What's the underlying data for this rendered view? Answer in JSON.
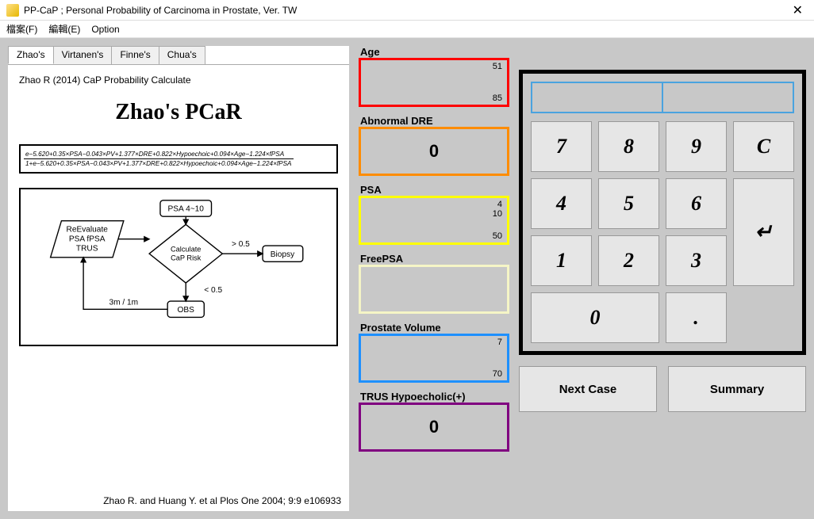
{
  "window": {
    "title": "PP-CaP ; Personal Probability of Carcinoma in Prostate, Ver. TW",
    "close": "✕"
  },
  "menubar": {
    "file": "檔案(F)",
    "edit": "編輯(E)",
    "option": "Option"
  },
  "tabs": {
    "zhao": "Zhao's",
    "virtanen": "Virtanen's",
    "finne": "Finne's",
    "chua": "Chua's"
  },
  "doc": {
    "subtitle": "Zhao R (2014) CaP Probability Calculate",
    "title": "Zhao's PCaR",
    "formula_num": "e−5.620+0.35×PSA−0.043×PV+1.377×DRE+0.822×Hypoechoic+0.094×Age−1.224×fPSA",
    "formula_den": "1+e−5.620+0.35×PSA−0.043×PV+1.377×DRE+0.822×Hypoechoic+0.094×Age−1.224×fPSA",
    "citation": "Zhao R.  and Huang Y. et al   Plos One 2004; 9:9 e106933",
    "flow": {
      "psa_range": "PSA 4~10",
      "reeval_l1": "ReEvaluate",
      "reeval_l2": "PSA  fPSA",
      "reeval_l3": "TRUS",
      "calc_l1": "Calculate",
      "calc_l2": "CaP Risk",
      "gt": "> 0.5",
      "lt": "< 0.5",
      "biopsy": "Biopsy",
      "obs": "OBS",
      "interval": "3m / 1m"
    }
  },
  "fields": {
    "age_label": "Age",
    "age_top": "51",
    "age_bot": "85",
    "dre_label": "Abnormal DRE",
    "dre_val": "0",
    "psa_label": "PSA",
    "psa_top": "4",
    "psa_mid": "10",
    "psa_bot": "50",
    "fpsa_label": "FreePSA",
    "pv_label": "Prostate Volume",
    "pv_top": "7",
    "pv_bot": "70",
    "trus_label": "TRUS Hypoecholic(+)",
    "trus_val": "0"
  },
  "keypad": {
    "k7": "7",
    "k8": "8",
    "k9": "9",
    "kc": "C",
    "k4": "4",
    "k5": "5",
    "k6": "6",
    "k1": "1",
    "k2": "2",
    "k3": "3",
    "kenter": "↵",
    "k0": "0",
    "kdot": "."
  },
  "buttons": {
    "next": "Next Case",
    "summary": "Summary"
  }
}
